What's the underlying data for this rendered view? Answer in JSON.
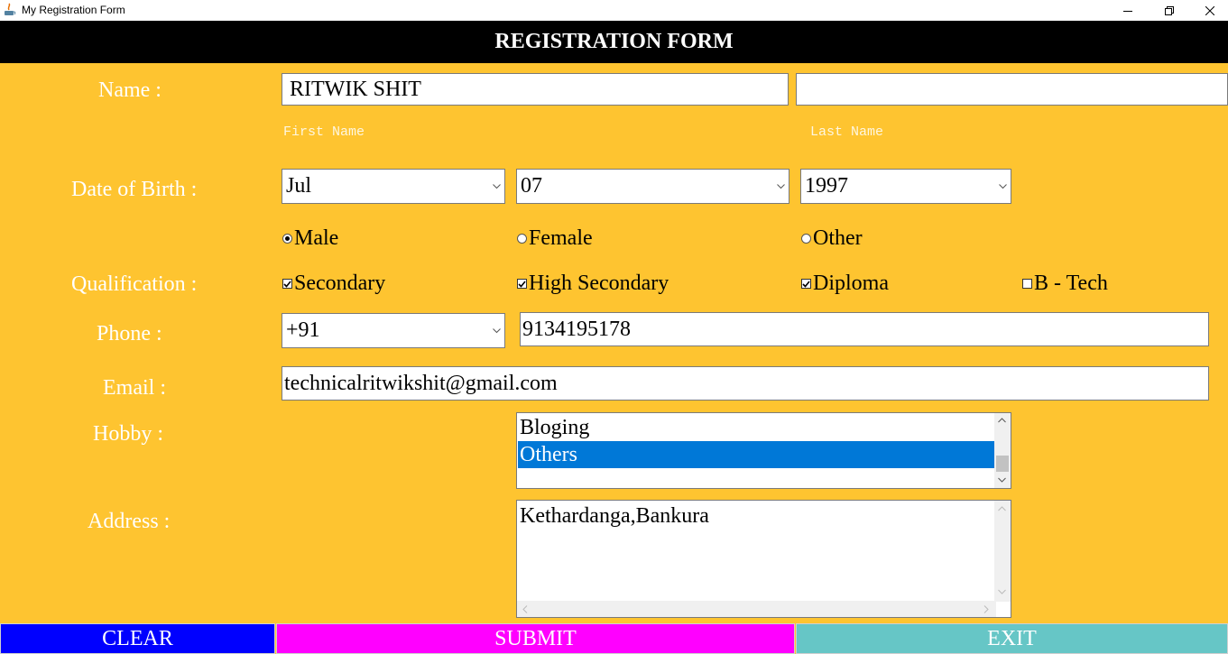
{
  "window": {
    "title": "My Registration Form"
  },
  "header": {
    "title": "REGISTRATION FORM"
  },
  "labels": {
    "name": "Name :",
    "dob": "Date of Birth :",
    "qualification": "Qualification :",
    "phone": "Phone :",
    "email": "Email :",
    "hobby": "Hobby :",
    "address": "Address :"
  },
  "name": {
    "first_value": "RITWIK SHIT",
    "last_value": "",
    "first_hint": "First Name",
    "last_hint": "Last Name"
  },
  "dob": {
    "month": "Jul",
    "day": "07",
    "year": "1997"
  },
  "gender": {
    "options": [
      "Male",
      "Female",
      "Other"
    ],
    "selected": "Male"
  },
  "qualification": {
    "options": [
      {
        "label": "Secondary",
        "checked": true
      },
      {
        "label": "High Secondary",
        "checked": true
      },
      {
        "label": "Diploma",
        "checked": true
      },
      {
        "label": "B - Tech",
        "checked": false
      }
    ]
  },
  "phone": {
    "code": "+91",
    "number": "9134195178"
  },
  "email": {
    "value": "technicalritwikshit@gmail.com"
  },
  "hobby": {
    "items": [
      "Bloging",
      "Others"
    ],
    "selected": "Others"
  },
  "address": {
    "value": "Kethardanga,Bankura"
  },
  "buttons": {
    "clear": "CLEAR",
    "submit": "SUBMIT",
    "exit": "EXIT"
  },
  "colors": {
    "background": "#fec430",
    "header": "#000000",
    "clear": "#0000ff",
    "submit": "#ff00ff",
    "exit": "#66c6c6",
    "selection": "#0078d7"
  }
}
